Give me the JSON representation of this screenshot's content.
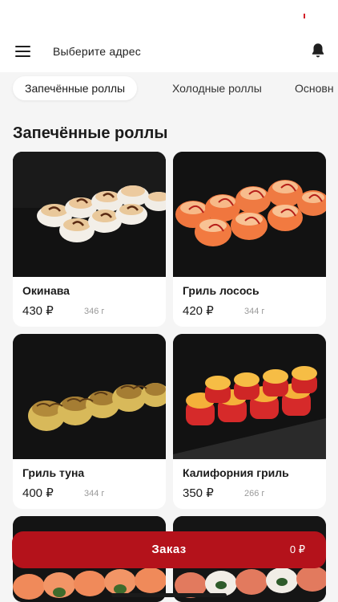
{
  "header": {
    "address_label": "Выберите адрес"
  },
  "tabs": [
    {
      "label": "Запечённые роллы",
      "active": true
    },
    {
      "label": "Холодные роллы",
      "active": false
    },
    {
      "label": "Основн",
      "active": false
    }
  ],
  "section": {
    "title": "Запечённые роллы"
  },
  "products": [
    {
      "name": "Окинава",
      "price": "430 ₽",
      "weight": "346 г"
    },
    {
      "name": "Гриль лосось",
      "price": "420 ₽",
      "weight": "344 г"
    },
    {
      "name": "Гриль туна",
      "price": "400 ₽",
      "weight": "344 г"
    },
    {
      "name": "Калифорния гриль",
      "price": "350 ₽",
      "weight": "266 г"
    }
  ],
  "order": {
    "label": "Заказ",
    "sum": "0 ₽"
  },
  "colors": {
    "accent": "#b4121b",
    "background": "#f5f5f5"
  },
  "icons": [
    "menu-icon",
    "bell-icon"
  ]
}
